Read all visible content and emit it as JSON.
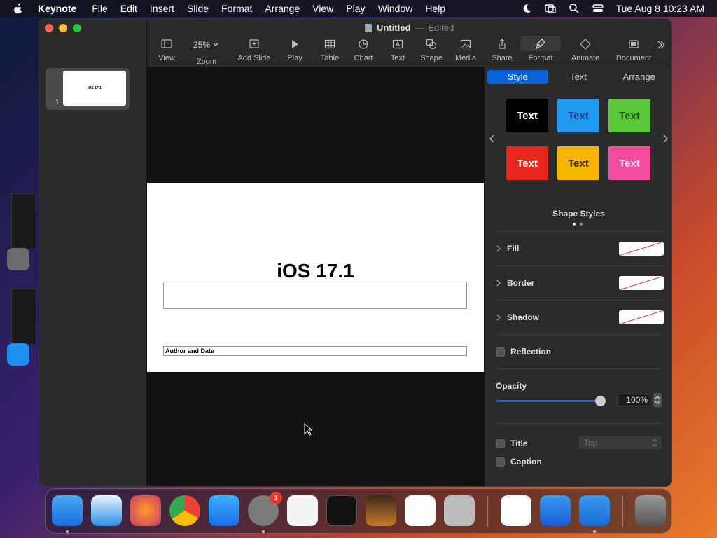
{
  "menubar": {
    "app": "Keynote",
    "items": [
      "File",
      "Edit",
      "Insert",
      "Slide",
      "Format",
      "Arrange",
      "View",
      "Play",
      "Window",
      "Help"
    ],
    "datetime": "Tue Aug 8  10:23 AM"
  },
  "window": {
    "doc_title": "Untitled",
    "doc_status": "Edited",
    "dash": "—"
  },
  "toolbar": {
    "zoom_value": "25%",
    "items": [
      "View",
      "Zoom",
      "Add Slide",
      "Play",
      "Table",
      "Chart",
      "Text",
      "Shape",
      "Media",
      "Share",
      "Format",
      "Animate",
      "Document"
    ]
  },
  "navigator": {
    "slide_number": "1",
    "thumb_title": "iOS 17.1"
  },
  "slide": {
    "title": "iOS 17.1",
    "author": "Author and Date"
  },
  "inspector": {
    "tabs": [
      "Style",
      "Text",
      "Arrange"
    ],
    "styles": [
      {
        "label": "Text",
        "bg": "#000000",
        "fg": "#ffffff"
      },
      {
        "label": "Text",
        "bg": "#1e9bf0",
        "fg": "#1a3a8a"
      },
      {
        "label": "Text",
        "bg": "#5ac83a",
        "fg": "#1a5a1a"
      },
      {
        "label": "Text",
        "bg": "#e8261c",
        "fg": "#ffffff"
      },
      {
        "label": "Text",
        "bg": "#f7b500",
        "fg": "#3a2a00"
      },
      {
        "label": "Text",
        "bg": "#f24ba0",
        "fg": "#ffe0f0"
      }
    ],
    "shape_styles_label": "Shape Styles",
    "fill_label": "Fill",
    "border_label": "Border",
    "shadow_label": "Shadow",
    "reflection_label": "Reflection",
    "opacity_label": "Opacity",
    "opacity_value": "100%",
    "opacity_level": 1.0,
    "title_label": "Title",
    "caption_label": "Caption",
    "title_position": "Top"
  },
  "dock": {
    "settings_badge": "1"
  },
  "colors": {
    "accent": "#0a64d8"
  }
}
